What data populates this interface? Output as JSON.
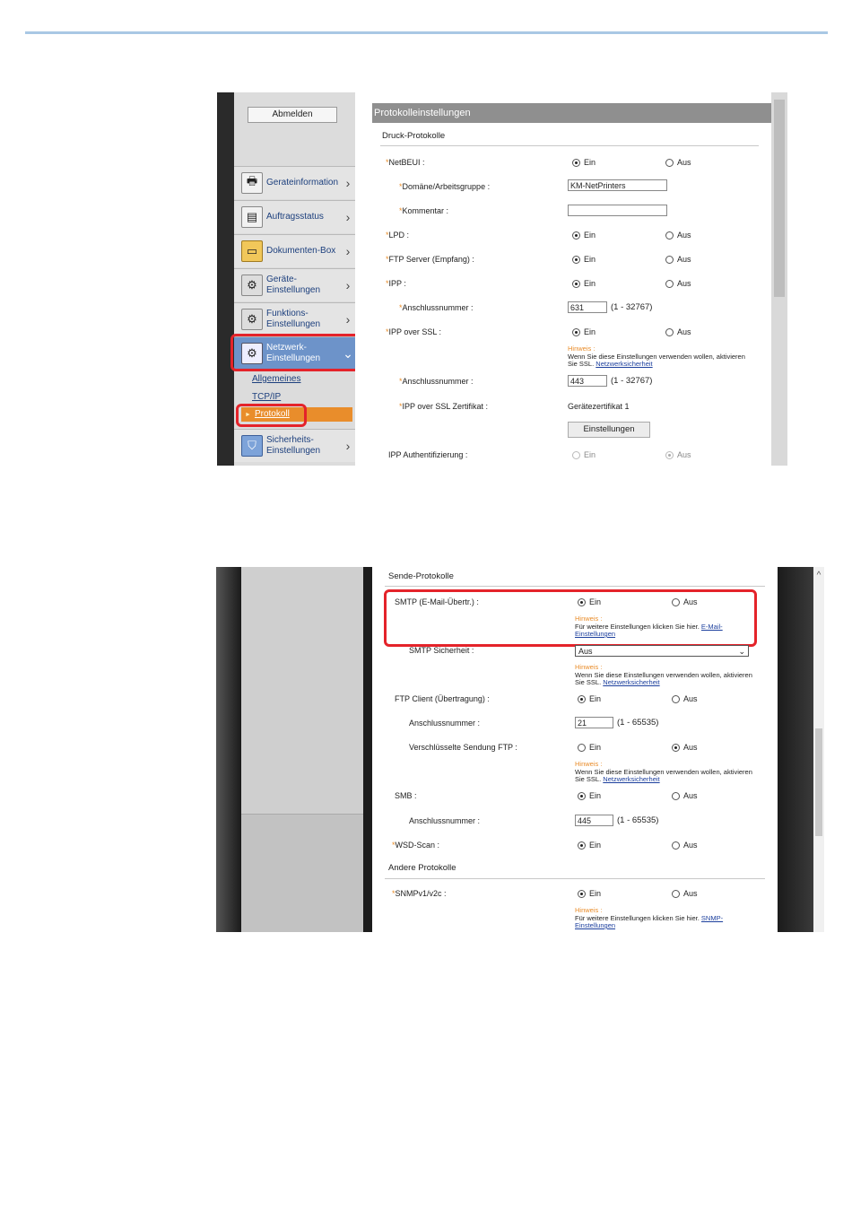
{
  "shot1": {
    "sidebar": {
      "logout_label": "Abmelden",
      "items": [
        {
          "label": "Gerateinformation",
          "icon": "device-info-icon"
        },
        {
          "label": "Auftragsstatus",
          "icon": "job-status-icon"
        },
        {
          "label": "Dokumenten-Box",
          "icon": "document-box-icon"
        },
        {
          "label": "Geräte-\nEinstellungen",
          "icon": "device-settings-icon"
        },
        {
          "label": "Funktions-\nEinstellungen",
          "icon": "function-settings-icon"
        },
        {
          "label": "Netzwerk-\nEinstellungen",
          "icon": "network-settings-icon"
        },
        {
          "label": "Sicherheits-\nEinstellungen",
          "icon": "security-settings-icon"
        }
      ],
      "sub_items": [
        "Allgemeines",
        "TCP/IP",
        "Protokoll"
      ]
    },
    "title": "Protokolleinstellungen",
    "section": "Druck-Protokolle",
    "rows": {
      "netbeui": {
        "label": "NetBEUI :",
        "on": "Ein",
        "off": "Aus"
      },
      "domain": {
        "label": "Domäne/Arbeitsgruppe :",
        "value": "KM-NetPrinters"
      },
      "comment": {
        "label": "Kommentar :",
        "value": ""
      },
      "lpd": {
        "label": "LPD :",
        "on": "Ein",
        "off": "Aus"
      },
      "ftp_server": {
        "label": "FTP Server (Empfang) :",
        "on": "Ein",
        "off": "Aus"
      },
      "ipp": {
        "label": "IPP :",
        "on": "Ein",
        "off": "Aus"
      },
      "ipp_port": {
        "label": "Anschlussnummer :",
        "value": "631",
        "range": "(1 - 32767)"
      },
      "ipp_ssl": {
        "label": "IPP over SSL :",
        "on": "Ein",
        "off": "Aus",
        "hint_title": "Hinweis :",
        "hint_text": "Wenn Sie diese Einstellungen verwenden wollen, aktivieren Sie SSL.",
        "hint_link": "Netzwerksicherheit"
      },
      "ipp_ssl_port": {
        "label": "Anschlussnummer :",
        "value": "443",
        "range": "(1 - 32767)"
      },
      "ipp_ssl_cert": {
        "label": "IPP over SSL Zertifikat :",
        "value": "Gerätezertifikat 1",
        "button": "Einstellungen"
      },
      "ipp_auth": {
        "label": "IPP Authentifizierung :",
        "on": "Ein",
        "off": "Aus"
      }
    }
  },
  "shot2": {
    "section_send": "Sende-Protokolle",
    "section_other": "Andere Protokolle",
    "rows": {
      "smtp": {
        "label": "SMTP (E-Mail-Übertr.) :",
        "on": "Ein",
        "off": "Aus",
        "hint_title": "Hinweis :",
        "hint_text": "Für weitere Einstellungen klicken Sie hier.",
        "hint_link": "E-Mail-Einstellungen"
      },
      "smtp_sec": {
        "label": "SMTP Sicherheit :",
        "value": "Aus",
        "hint_title": "Hinweis :",
        "hint_text": "Wenn Sie diese Einstellungen verwenden wollen, aktivieren Sie SSL.",
        "hint_link": "Netzwerksicherheit"
      },
      "ftp_client": {
        "label": "FTP Client (Übertragung) :",
        "on": "Ein",
        "off": "Aus"
      },
      "ftp_port": {
        "label": "Anschlussnummer :",
        "value": "21",
        "range": "(1 - 65535)"
      },
      "ftps": {
        "label": "Verschlüsselte Sendung FTP :",
        "on": "Ein",
        "off": "Aus",
        "hint_title": "Hinweis :",
        "hint_text": "Wenn Sie diese Einstellungen verwenden wollen, aktivieren Sie SSL.",
        "hint_link": "Netzwerksicherheit"
      },
      "smb": {
        "label": "SMB :",
        "on": "Ein",
        "off": "Aus"
      },
      "smb_port": {
        "label": "Anschlussnummer :",
        "value": "445",
        "range": "(1 - 65535)"
      },
      "wsd": {
        "label": "WSD-Scan :",
        "on": "Ein",
        "off": "Aus"
      },
      "snmp": {
        "label": "SNMPv1/v2c :",
        "on": "Ein",
        "off": "Aus",
        "hint_title": "Hinweis :",
        "hint_text": "Für weitere Einstellungen klicken Sie hier.",
        "hint_link": "SNMP-Einstellungen"
      }
    }
  },
  "colors": {
    "accent_orange": "#e98d2b",
    "highlight_red": "#e4232a",
    "nav_active": "#6d93c9",
    "link_blue": "#1c3f9d"
  }
}
